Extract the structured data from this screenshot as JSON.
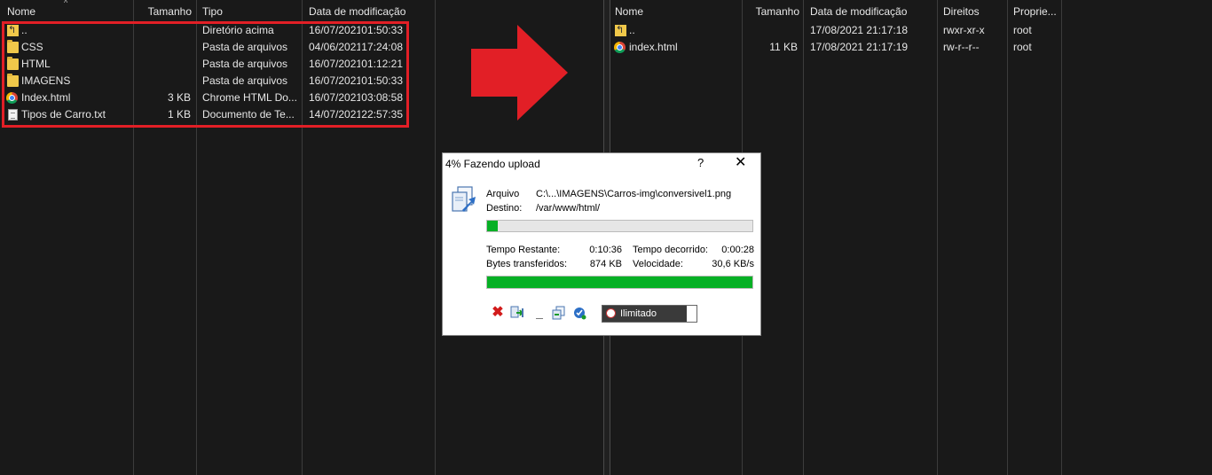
{
  "left_pane": {
    "columns": {
      "name": "Nome",
      "size": "Tamanho",
      "type": "Tipo",
      "modified": "Data de modificação"
    },
    "rows": [
      {
        "icon": "parent-folder-icon",
        "name": "..",
        "size": "",
        "type": "Diretório acima",
        "date": "16/07/2021",
        "time": "01:50:33"
      },
      {
        "icon": "folder-icon",
        "name": "CSS",
        "size": "",
        "type": "Pasta de arquivos",
        "date": "04/06/2021",
        "time": "17:24:08"
      },
      {
        "icon": "folder-icon",
        "name": "HTML",
        "size": "",
        "type": "Pasta de arquivos",
        "date": "16/07/2021",
        "time": "01:12:21"
      },
      {
        "icon": "folder-icon",
        "name": "IMAGENS",
        "size": "",
        "type": "Pasta de arquivos",
        "date": "16/07/2021",
        "time": "01:50:33"
      },
      {
        "icon": "chrome-icon",
        "name": "Index.html",
        "size": "3 KB",
        "type": "Chrome HTML Do...",
        "date": "16/07/2021",
        "time": "03:08:58"
      },
      {
        "icon": "text-file-icon",
        "name": "Tipos de Carro.txt",
        "size": "1 KB",
        "type": "Documento de Te...",
        "date": "14/07/2021",
        "time": "22:57:35"
      }
    ]
  },
  "right_pane": {
    "columns": {
      "name": "Nome",
      "size": "Tamanho",
      "modified": "Data de modificação",
      "rights": "Direitos",
      "owner": "Proprie..."
    },
    "rows": [
      {
        "icon": "parent-folder-icon",
        "name": "..",
        "size": "",
        "modified": "17/08/2021 21:17:18",
        "rights": "rwxr-xr-x",
        "owner": "root"
      },
      {
        "icon": "chrome-icon",
        "name": "index.html",
        "size": "11 KB",
        "modified": "17/08/2021 21:17:19",
        "rights": "rw-r--r--",
        "owner": "root"
      }
    ]
  },
  "dialog": {
    "title": "4% Fazendo upload",
    "help": "?",
    "close": "✕",
    "file_label": "Arquivo",
    "file_value": "C:\\...\\IMAGENS\\Carros-img\\conversivel1.png",
    "dest_label": "Destino:",
    "dest_value": "/var/www/html/",
    "file_progress": 0.04,
    "total_progress": 1.0,
    "remaining_label": "Tempo Restante:",
    "remaining_value": "0:10:36",
    "elapsed_label": "Tempo decorrido:",
    "elapsed_value": "0:00:28",
    "bytes_label": "Bytes transferidos:",
    "bytes_value": "874 KB",
    "speed_label": "Velocidade:",
    "speed_value": "30,6 KB/s",
    "speed_limit": "Ilimitado"
  },
  "colors": {
    "highlight": "#e21f26",
    "progress": "#06b025"
  }
}
